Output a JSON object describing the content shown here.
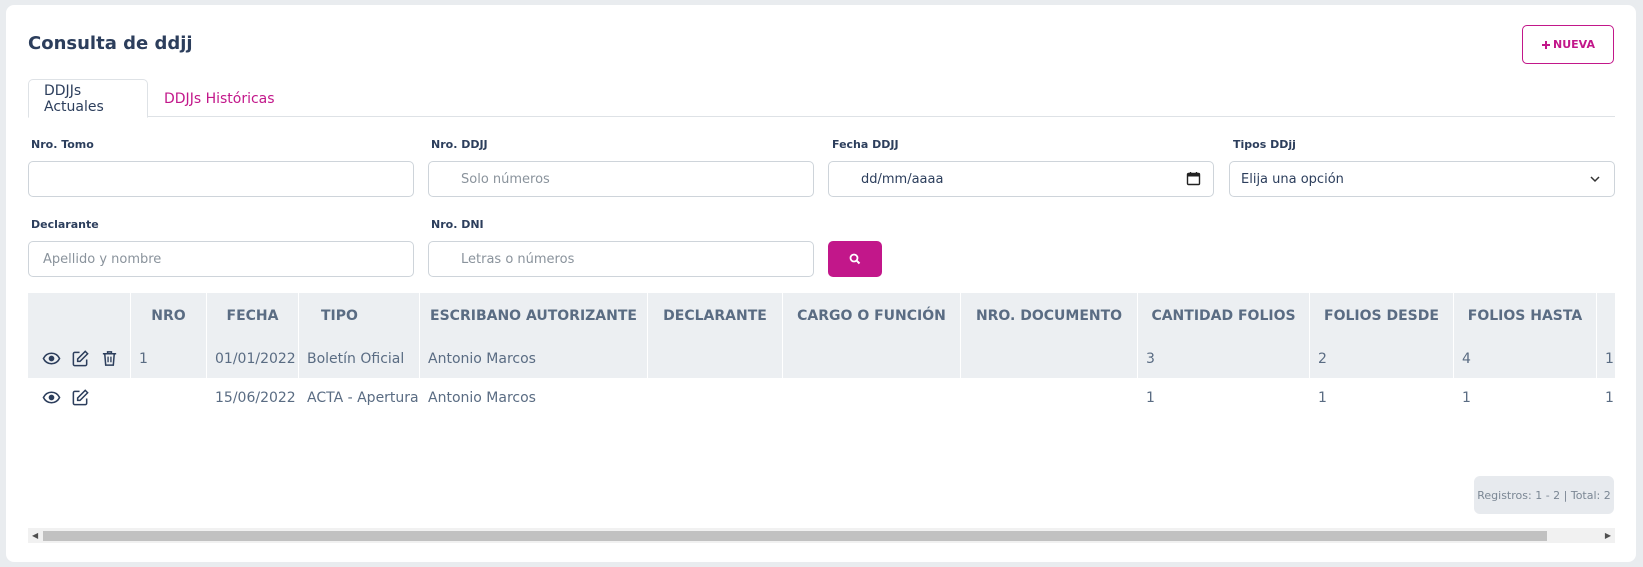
{
  "page": {
    "title": "Consulta de ddjj",
    "new_button_label": "NUEVA",
    "new_button_icon": "plus-icon"
  },
  "tabs": [
    {
      "label": "DDJJs Actuales",
      "active": true
    },
    {
      "label": "DDJJs Históricas",
      "active": false
    }
  ],
  "filters": {
    "nro_tomo": {
      "label": "Nro. Tomo",
      "placeholder": "",
      "value": ""
    },
    "nro_ddjj": {
      "label": "Nro. DDJJ",
      "placeholder": "Solo números",
      "value": ""
    },
    "fecha_ddjj": {
      "label": "Fecha DDJJ",
      "placeholder": "dd/mm/aaaa",
      "value": ""
    },
    "tipos_ddjj": {
      "label": "Tipos DDjj",
      "selected": "Elija una opción"
    },
    "declarante": {
      "label": "Declarante",
      "placeholder": "Apellido y nombre",
      "value": ""
    },
    "nro_dni": {
      "label": "Nro. DNI",
      "placeholder": "Letras o números",
      "value": ""
    },
    "search_icon": "search-icon"
  },
  "table": {
    "columns": [
      "",
      "NRO",
      "FECHA",
      "TIPO",
      "ESCRIBANO AUTORIZANTE",
      "DECLARANTE",
      "CARGO O FUNCIÓN",
      "NRO. DOCUMENTO",
      "CANTIDAD FOLIOS",
      "FOLIOS DESDE",
      "FOLIOS HASTA",
      ""
    ],
    "rows": [
      {
        "actions": [
          "view-icon",
          "edit-icon",
          "delete-icon"
        ],
        "nro": "1",
        "fecha": "01/01/2022",
        "tipo": "Boletín Oficial",
        "escribano": "Antonio Marcos",
        "declarante": "",
        "cargo": "",
        "nro_documento": "",
        "cantidad_folios": "3",
        "folios_desde": "2",
        "folios_hasta": "4",
        "extra": "1"
      },
      {
        "actions": [
          "view-icon",
          "edit-icon"
        ],
        "nro": "",
        "fecha": "15/06/2022",
        "tipo": "ACTA - Apertura",
        "escribano": "Antonio Marcos",
        "declarante": "",
        "cargo": "",
        "nro_documento": "",
        "cantidad_folios": "1",
        "folios_desde": "1",
        "folios_hasta": "1",
        "extra": "1"
      }
    ]
  },
  "pagination": {
    "summary": "Registros: 1 - 2 | Total: 2"
  },
  "colors": {
    "accent": "#c2178a",
    "title": "#2c3e5c",
    "table_stripe": "#eceff2"
  }
}
